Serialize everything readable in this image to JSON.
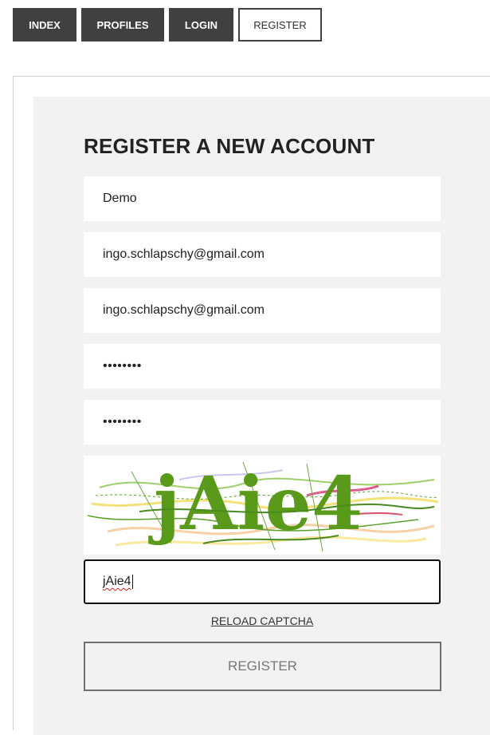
{
  "nav": {
    "items": [
      {
        "label": "INDEX",
        "active": false
      },
      {
        "label": "PROFILES",
        "active": false
      },
      {
        "label": "LOGIN",
        "active": false
      },
      {
        "label": "REGISTER",
        "active": true
      }
    ]
  },
  "form": {
    "title": "REGISTER A NEW ACCOUNT",
    "fields": {
      "username": "Demo",
      "email": "ingo.schlapschy@gmail.com",
      "email_confirm": "ingo.schlapschy@gmail.com",
      "password": "••••••••",
      "password_confirm": "••••••••",
      "captcha_input": "jAie4"
    },
    "captcha_image_text": "jAie4",
    "reload_label": "RELOAD CAPTCHA",
    "submit_label": "REGISTER"
  },
  "colors": {
    "nav_bg": "#404040",
    "panel_bg": "#f3f2f0",
    "captcha_text": "#5a9a1a"
  }
}
